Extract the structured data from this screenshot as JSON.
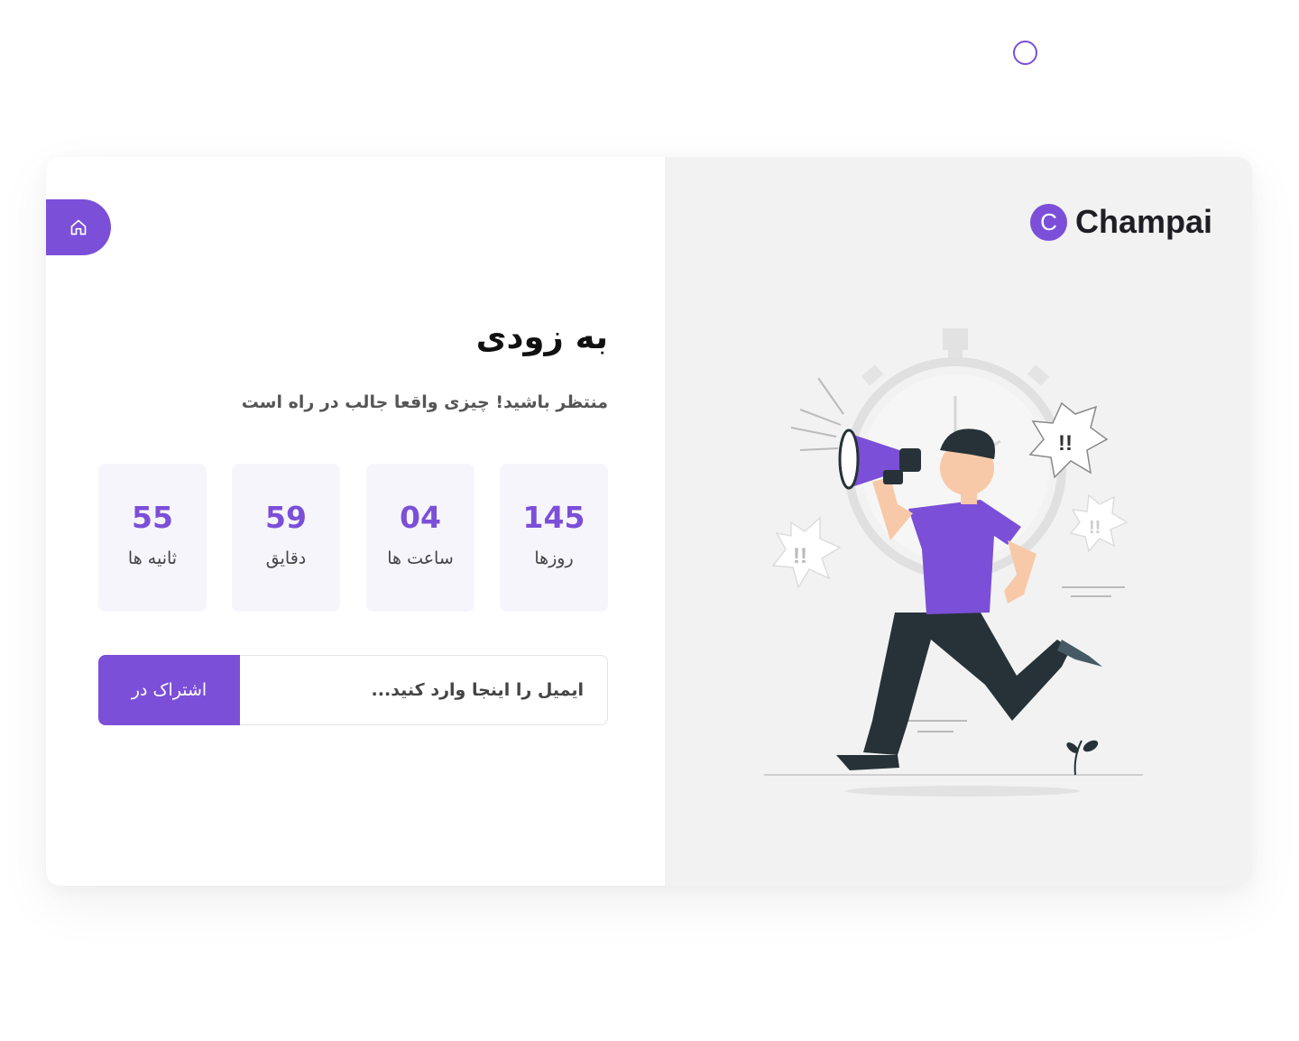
{
  "brand": {
    "name": "Champai",
    "logo_letter": "C",
    "accent_color": "#7b4fd8"
  },
  "nav": {
    "home_icon": "home-icon"
  },
  "hero": {
    "title": "به زودی",
    "subtitle": "منتظر باشید! چیزی واقعا جالب در راه است"
  },
  "countdown": [
    {
      "value": "145",
      "label": "روزها"
    },
    {
      "value": "04",
      "label": "ساعت ها"
    },
    {
      "value": "59",
      "label": "دقایق"
    },
    {
      "value": "55",
      "label": "ثانیه ها"
    }
  ],
  "subscribe": {
    "placeholder": "ایمیل را اینجا وارد کنید...",
    "button_label": "اشتراک در"
  },
  "illustration": {
    "alert_text_1": "!!",
    "alert_text_2": "!!",
    "alert_text_3": "!!"
  }
}
